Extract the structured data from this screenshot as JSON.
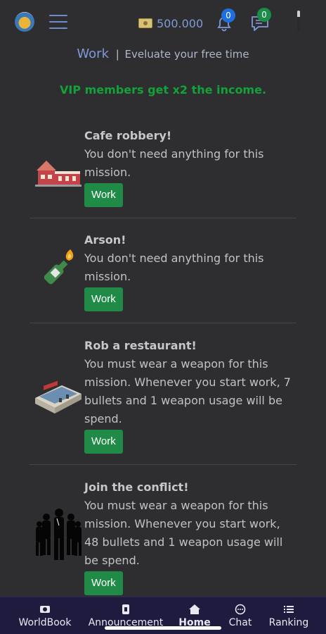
{
  "header": {
    "money": "500.000",
    "notifications_count": "0",
    "messages_count": "0"
  },
  "page": {
    "title": "Work",
    "separator": "|",
    "subtitle": "Eveluate your free time",
    "vip_notice": "VIP members get x2 the income."
  },
  "missions": [
    {
      "title": "Cafe robbery!",
      "description": "You don't need anything for this mission.",
      "button": "Work",
      "icon": "cafe-building-icon"
    },
    {
      "title": "Arson!",
      "description": "You don't need anything for this mission.",
      "button": "Work",
      "icon": "molotov-icon"
    },
    {
      "title": "Rob a restaurant!",
      "description": "You must wear a weapon for this mission. Whenever you start work, 7 bullets and 1 weapon usage will be spend.",
      "button": "Work",
      "icon": "restaurant-building-icon"
    },
    {
      "title": "Join the conflict!",
      "description": "You must wear a weapon for this mission. Whenever you start work, 48 bullets and 1 weapon usage will be spend.",
      "button": "Work",
      "icon": "gang-silhouette-icon"
    }
  ],
  "bottom_nav": [
    {
      "label": "WorldBook",
      "icon": "worldbook-icon"
    },
    {
      "label": "Announcement",
      "icon": "announcement-icon"
    },
    {
      "label": "Home",
      "icon": "home-icon",
      "active": true
    },
    {
      "label": "Chat",
      "icon": "chat-icon"
    },
    {
      "label": "Ranking",
      "icon": "ranking-icon"
    }
  ],
  "colors": {
    "background": "#2e2e30",
    "accent_blue": "#7f9ad6",
    "vip_green": "#13a13a",
    "button_green": "#1f8b47",
    "nav_background": "#1f1b3f"
  }
}
